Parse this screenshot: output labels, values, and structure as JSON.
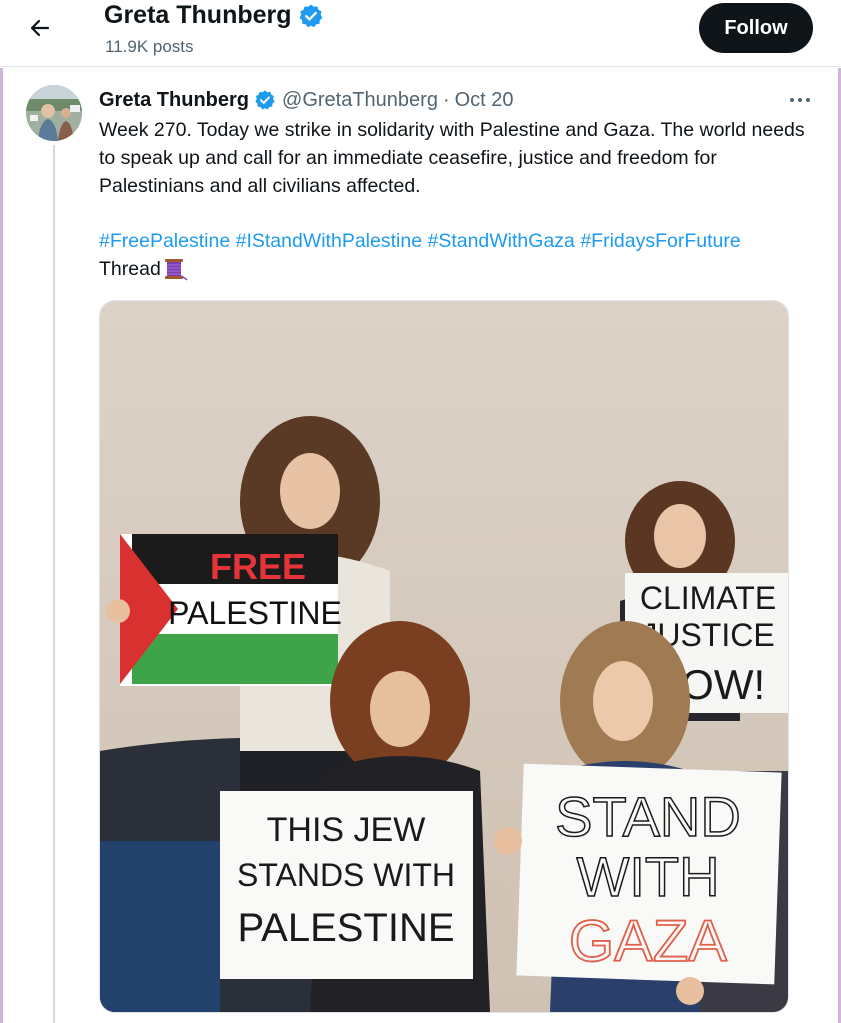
{
  "header": {
    "name": "Greta Thunberg",
    "posts_count": "11.9K posts",
    "follow_label": "Follow"
  },
  "post": {
    "name": "Greta Thunberg",
    "handle": "@GretaThunberg",
    "separator": "·",
    "date": "Oct 20",
    "text": "Week 270. Today we strike in solidarity with Palestine and Gaza. The world needs to speak up and call for an immediate ceasefire, justice and freedom for Palestinians and all civilians affected.",
    "hashtags": [
      "#FreePalestine",
      "#IStandWithPalestine",
      "#StandWithGaza",
      "#FridaysForFuture"
    ],
    "thread_label": "Thread",
    "thread_emoji": "spool-of-thread-icon"
  },
  "media": {
    "signs": {
      "free_palestine": [
        "FREE",
        "PALESTINE"
      ],
      "climate_justice": [
        "CLIMATE",
        "JUSTICE",
        "NOW!"
      ],
      "this_jew": [
        "THIS JEW",
        "STANDS WITH",
        "PALESTINE"
      ],
      "stand_with_gaza": [
        "STAND",
        "WITH",
        "GAZA"
      ]
    }
  },
  "colors": {
    "verified": "#1d9bf0",
    "link": "#1d9bf0",
    "follow_bg": "#0f1419",
    "muted": "#536471"
  }
}
